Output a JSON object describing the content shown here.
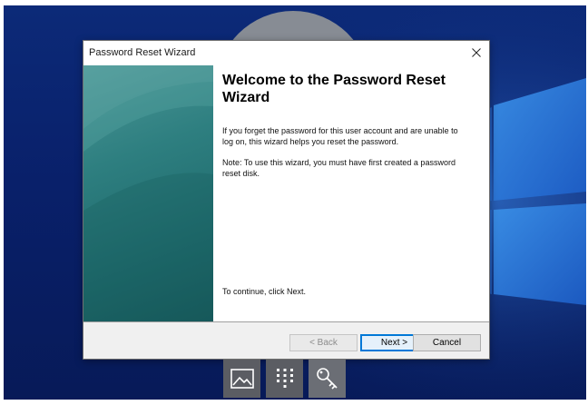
{
  "dialog": {
    "title": "Password Reset Wizard",
    "heading": "Welcome to the Password Reset Wizard",
    "paragraph_1": "If you forget the password for this user account and are unable to log on, this wizard helps you reset the password.",
    "paragraph_2": "Note: To use this wizard, you must have first created a password reset disk.",
    "paragraph_3": "To continue, click Next.",
    "close_icon": "close-icon"
  },
  "buttons": {
    "back_label": "< Back",
    "next_label": "Next >",
    "cancel_label": "Cancel",
    "back_enabled": false
  },
  "signin_options": {
    "icons": [
      "picture-icon",
      "pin-keypad-icon",
      "key-icon"
    ]
  },
  "colors": {
    "desktop_background": "#0c2a78",
    "side_panel": "#2e7f80",
    "accent": "#0078d7"
  }
}
